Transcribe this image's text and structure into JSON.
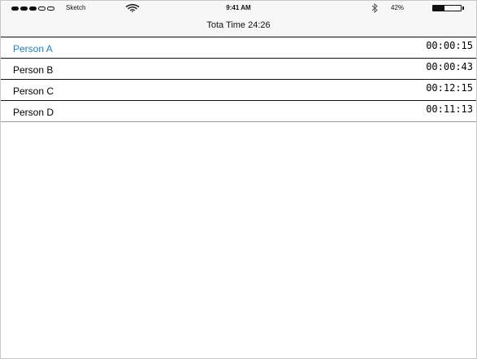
{
  "status_bar": {
    "carrier": "Sketch",
    "time": "9:41 AM",
    "battery_percent": "42%",
    "battery_level": 0.42,
    "signal_dots": [
      true,
      true,
      true,
      false,
      false
    ]
  },
  "nav": {
    "title": "Tota Time 24:26"
  },
  "colors": {
    "selected_text": "#1e7fc4",
    "bar_background": "#f7f7f7"
  },
  "people": [
    {
      "name": "Person A",
      "time": "00:00:15",
      "selected": true
    },
    {
      "name": "Person B",
      "time": "00:00:43",
      "selected": false
    },
    {
      "name": "Person C",
      "time": "00:12:15",
      "selected": false
    },
    {
      "name": "Person D",
      "time": "00:11:13",
      "selected": false
    }
  ]
}
